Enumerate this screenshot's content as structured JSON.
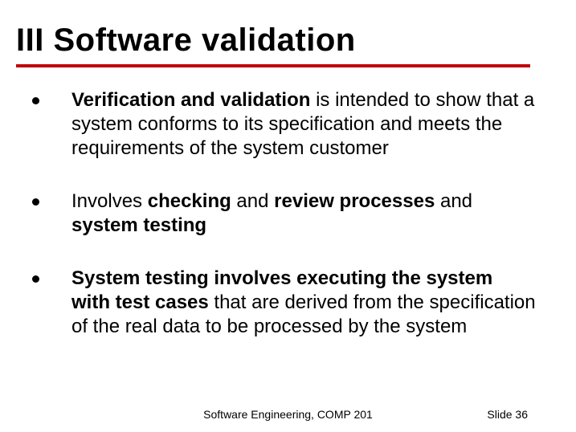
{
  "title": "III Software validation",
  "bullets": [
    {
      "runs": [
        {
          "text": "Verification and validation",
          "bold": true
        },
        {
          "text": " is intended to show that a system conforms to its specification and meets the requirements of the system customer",
          "bold": false
        }
      ]
    },
    {
      "runs": [
        {
          "text": "Involves ",
          "bold": false
        },
        {
          "text": "checking",
          "bold": true
        },
        {
          "text": " and ",
          "bold": false
        },
        {
          "text": "review processes",
          "bold": true
        },
        {
          "text": " and ",
          "bold": false
        },
        {
          "text": "system testing",
          "bold": true
        }
      ]
    },
    {
      "runs": [
        {
          "text": "System testing involves executing the system with test cases",
          "bold": true
        },
        {
          "text": " that are derived from the specification of the real data to be processed by the system",
          "bold": false
        }
      ]
    }
  ],
  "footer": {
    "center": "Software Engineering, COMP 201",
    "right_label": "Slide ",
    "right_number": "36"
  },
  "colors": {
    "rule": "#c00000"
  }
}
